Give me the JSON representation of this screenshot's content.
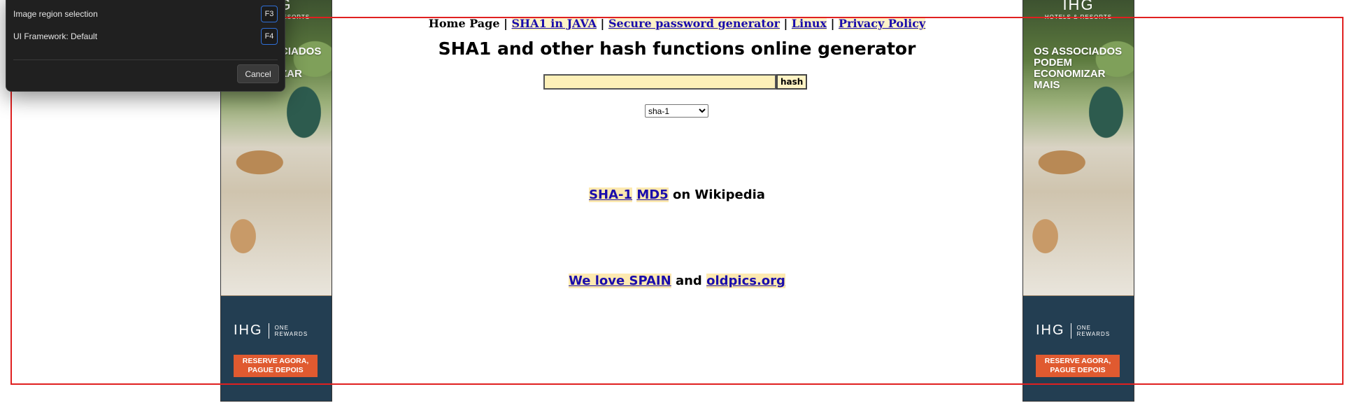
{
  "nav": {
    "home": "Home Page",
    "sep": " | ",
    "links": [
      "SHA1 in JAVA",
      "Secure password generator",
      "Linux",
      "Privacy Policy"
    ]
  },
  "title": "SHA1 and other hash functions online generator",
  "form": {
    "input_value": "",
    "button_label": "hash",
    "algorithm_selected": "sha-1"
  },
  "wiki": {
    "link1": "SHA-1",
    "link2": "MD5",
    "suffix": " on Wikipedia"
  },
  "love": {
    "link1": "We love SPAIN",
    "middle": " and ",
    "link2": "oldpics.org"
  },
  "ads": {
    "brand": "IHG",
    "brand_sub": "HOTELS & RESORTS",
    "headline": "OS ASSOCIADOS PODEM ECONOMIZAR MAIS",
    "left_headline_visible": "CIADOS ZAR",
    "rewards_brand": "IHG",
    "rewards_sub1": "ONE",
    "rewards_sub2": "REWARDS",
    "cta_line1": "RESERVE AGORA,",
    "cta_line2": "PAGUE DEPOIS"
  },
  "popup": {
    "items": [
      {
        "label": "Image region selection",
        "key": "F3"
      },
      {
        "label": "UI Framework: Default",
        "key": "F4"
      }
    ],
    "cancel_label": "Cancel"
  },
  "colors": {
    "link": "#1a0dab",
    "link_highlight": "#fdf3c8",
    "selection": "#e02020",
    "popup_bg": "#202020",
    "key_border": "#2f6fd6",
    "cta": "#e05a30",
    "ad_bottom": "#233e52"
  }
}
